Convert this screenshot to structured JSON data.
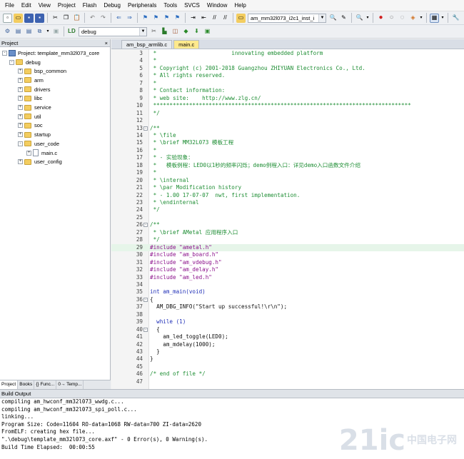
{
  "menu": [
    "File",
    "Edit",
    "View",
    "Project",
    "Flash",
    "Debug",
    "Peripherals",
    "Tools",
    "SVCS",
    "Window",
    "Help"
  ],
  "toolbar": {
    "target_combo": "am_mm32l073_i2c1_inst_i",
    "build_target": "debug"
  },
  "project_panel": {
    "title": "Project",
    "close_glyph": "×",
    "root": "Project: template_mm32l073_core",
    "target": "debug",
    "groups": [
      "bsp_common",
      "arm",
      "drivers",
      "libc",
      "service",
      "util",
      "soc",
      "startup",
      "user_code",
      "user_config"
    ],
    "open_group": "user_code",
    "open_file": "main.c",
    "tabs": [
      "Project",
      "Books",
      "{} Func...",
      "0→ Temp..."
    ]
  },
  "editor": {
    "tabs": [
      "am_bsp_armlib.c",
      "main.c"
    ],
    "active_tab": "main.c",
    "lines": [
      {
        "n": "3",
        "t": " *                       innovating embedded platform",
        "c": "cm"
      },
      {
        "n": "4",
        "t": " *",
        "c": "cm"
      },
      {
        "n": "5",
        "t": " * Copyright (c) 2001-2018 Guangzhou ZHIYUAN Electronics Co., Ltd.",
        "c": "cm"
      },
      {
        "n": "6",
        "t": " * All rights reserved.",
        "c": "cm"
      },
      {
        "n": "7",
        "t": " *",
        "c": "cm"
      },
      {
        "n": "8",
        "t": " * Contact information:",
        "c": "cm"
      },
      {
        "n": "9",
        "t": " * web site:    http://www.zlg.cn/",
        "c": "cm"
      },
      {
        "n": "10",
        "t": " *******************************************************************************",
        "c": "cm"
      },
      {
        "n": "11",
        "t": " */",
        "c": "cm"
      },
      {
        "n": "12",
        "t": "",
        "c": "plain"
      },
      {
        "n": "13",
        "t": "/**",
        "c": "cm",
        "fold": "-"
      },
      {
        "n": "14",
        "t": " * \\file",
        "c": "cm"
      },
      {
        "n": "15",
        "t": " * \\brief MM32L073 模板工程",
        "c": "cm"
      },
      {
        "n": "16",
        "t": " *",
        "c": "cm"
      },
      {
        "n": "17",
        "t": " * - 实验现象：",
        "c": "cm"
      },
      {
        "n": "18",
        "t": " *   模板例程：LED0以1秒的频率闪烁；demo例程入口：详见demo入口函数文件介绍",
        "c": "cm"
      },
      {
        "n": "19",
        "t": " *",
        "c": "cm"
      },
      {
        "n": "20",
        "t": " * \\internal",
        "c": "cm"
      },
      {
        "n": "21",
        "t": " * \\par Modification history",
        "c": "cm"
      },
      {
        "n": "22",
        "t": " * - 1.00 17-07-07  nwt, first implementation.",
        "c": "cm"
      },
      {
        "n": "23",
        "t": " * \\endinternal",
        "c": "cm"
      },
      {
        "n": "24",
        "t": " */",
        "c": "cm"
      },
      {
        "n": "25",
        "t": "",
        "c": "plain"
      },
      {
        "n": "26",
        "t": "/**",
        "c": "cm",
        "fold": "-"
      },
      {
        "n": "27",
        "t": " * \\brief AMetal 应用程序入口",
        "c": "cm"
      },
      {
        "n": "28",
        "t": " */",
        "c": "cm"
      },
      {
        "n": "29",
        "t": "#include \"ametal.h\"",
        "c": "str",
        "hl": true
      },
      {
        "n": "30",
        "t": "#include \"am_board.h\"",
        "c": "str"
      },
      {
        "n": "31",
        "t": "#include \"am_vdebug.h\"",
        "c": "str"
      },
      {
        "n": "32",
        "t": "#include \"am_delay.h\"",
        "c": "str"
      },
      {
        "n": "33",
        "t": "#include \"am_led.h\"",
        "c": "str"
      },
      {
        "n": "34",
        "t": "",
        "c": "plain"
      },
      {
        "n": "35",
        "t": "int am_main(void)",
        "c": "kw"
      },
      {
        "n": "36",
        "t": "{",
        "c": "plain",
        "fold": "-"
      },
      {
        "n": "37",
        "t": "  AM_DBG_INFO(\"Start up successful!\\r\\n\");",
        "c": "plain"
      },
      {
        "n": "38",
        "t": "",
        "c": "plain"
      },
      {
        "n": "39",
        "t": "  while (1)",
        "c": "kw"
      },
      {
        "n": "40",
        "t": "  {",
        "c": "plain",
        "fold": "-"
      },
      {
        "n": "41",
        "t": "    am_led_toggle(LED0);",
        "c": "plain"
      },
      {
        "n": "42",
        "t": "    am_mdelay(1000);",
        "c": "plain"
      },
      {
        "n": "43",
        "t": "  }",
        "c": "plain"
      },
      {
        "n": "44",
        "t": "}",
        "c": "plain"
      },
      {
        "n": "45",
        "t": "",
        "c": "plain"
      },
      {
        "n": "46",
        "t": "/* end of file */",
        "c": "cm"
      },
      {
        "n": "47",
        "t": "",
        "c": "plain"
      }
    ]
  },
  "build_output": {
    "title": "Build Output",
    "lines": [
      "compiling am_hwconf_mm32l073_wwdg.c...",
      "compiling am_hwconf_mm32l073_spi_poll.c...",
      "linking...",
      "Program Size: Code=11604 RO-data=1068 RW-data=700 ZI-data=2620",
      "FromELF: creating hex file...",
      "\".\\debug\\template_mm32l073_core.axf\" - 0 Error(s), 0 Warning(s).",
      "Build Time Elapsed:  00:00:55"
    ]
  },
  "watermark": {
    "logo": "21ic",
    "sub": "中国电子网"
  }
}
